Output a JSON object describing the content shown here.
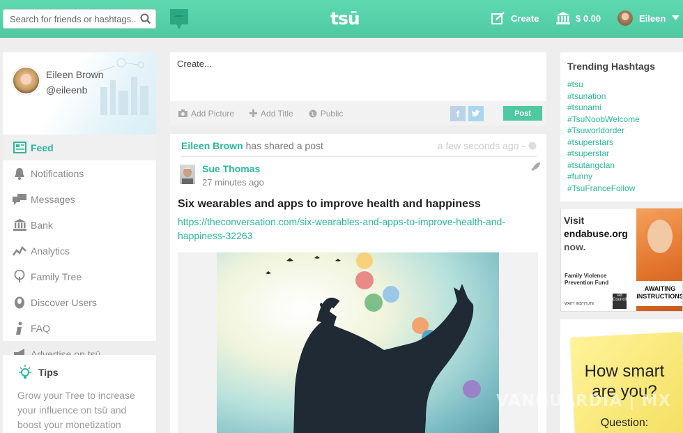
{
  "topbar": {
    "search_placeholder": "Search for friends or hashtags...",
    "logo": "tsū",
    "create_label": "Create",
    "balance": "$ 0.00",
    "user_name": "Eileen"
  },
  "profile": {
    "name": "Eileen Brown",
    "handle": "@eileenb"
  },
  "nav": [
    {
      "label": "Feed",
      "icon": "feed-icon"
    },
    {
      "label": "Notifications",
      "icon": "bell-icon"
    },
    {
      "label": "Messages",
      "icon": "messages-icon"
    },
    {
      "label": "Bank",
      "icon": "bank-icon"
    },
    {
      "label": "Analytics",
      "icon": "analytics-icon"
    },
    {
      "label": "Family Tree",
      "icon": "tree-icon"
    },
    {
      "label": "Discover Users",
      "icon": "user-icon"
    },
    {
      "label": "FAQ",
      "icon": "info-icon"
    },
    {
      "label": "Advertise on tsū",
      "icon": "megaphone-icon"
    }
  ],
  "tips": {
    "title": "Tips",
    "body": "Grow your Tree to increase your influence on tsū and boost your monetization"
  },
  "compose": {
    "placeholder": "Create...",
    "add_picture": "Add Picture",
    "add_title": "Add Title",
    "visibility": "Public",
    "post_label": "Post"
  },
  "feed_post": {
    "sharer": "Eileen Brown",
    "share_text": "has shared a post",
    "share_time": "a few seconds ago -",
    "author": "Sue Thomas",
    "time": "27 minutes ago",
    "title": "Six wearables and apps to improve health and happiness",
    "link": "https://theconversation.com/six-wearables-and-apps-to-improve-health-and-happiness-32263"
  },
  "trending": {
    "title": "Trending Hashtags",
    "tags": [
      "#tsu",
      "#tsunation",
      "#tsunami",
      "#TsuNoobWelcome",
      "#Tsuworldorder",
      "#tsuperstars",
      "#tsuperstar",
      "#tsutangclan",
      "#funny",
      "#TsuFranceFollow"
    ]
  },
  "ad_endabuse": {
    "line1": "Visit",
    "line2": "endabuse.org",
    "line3": "now.",
    "fund": "Family Violence Prevention Fund",
    "sign": "AWAITING INSTRUCTIONS",
    "org": "WAITT INSTITUTE",
    "badge": "Ad Council"
  },
  "ad_smart": {
    "headline": "How smart are you?",
    "question": "Question:"
  },
  "watermark": "VANGUARDIA | MX",
  "colors": {
    "accent": "#4ec9a2",
    "link": "#2bb89a"
  }
}
